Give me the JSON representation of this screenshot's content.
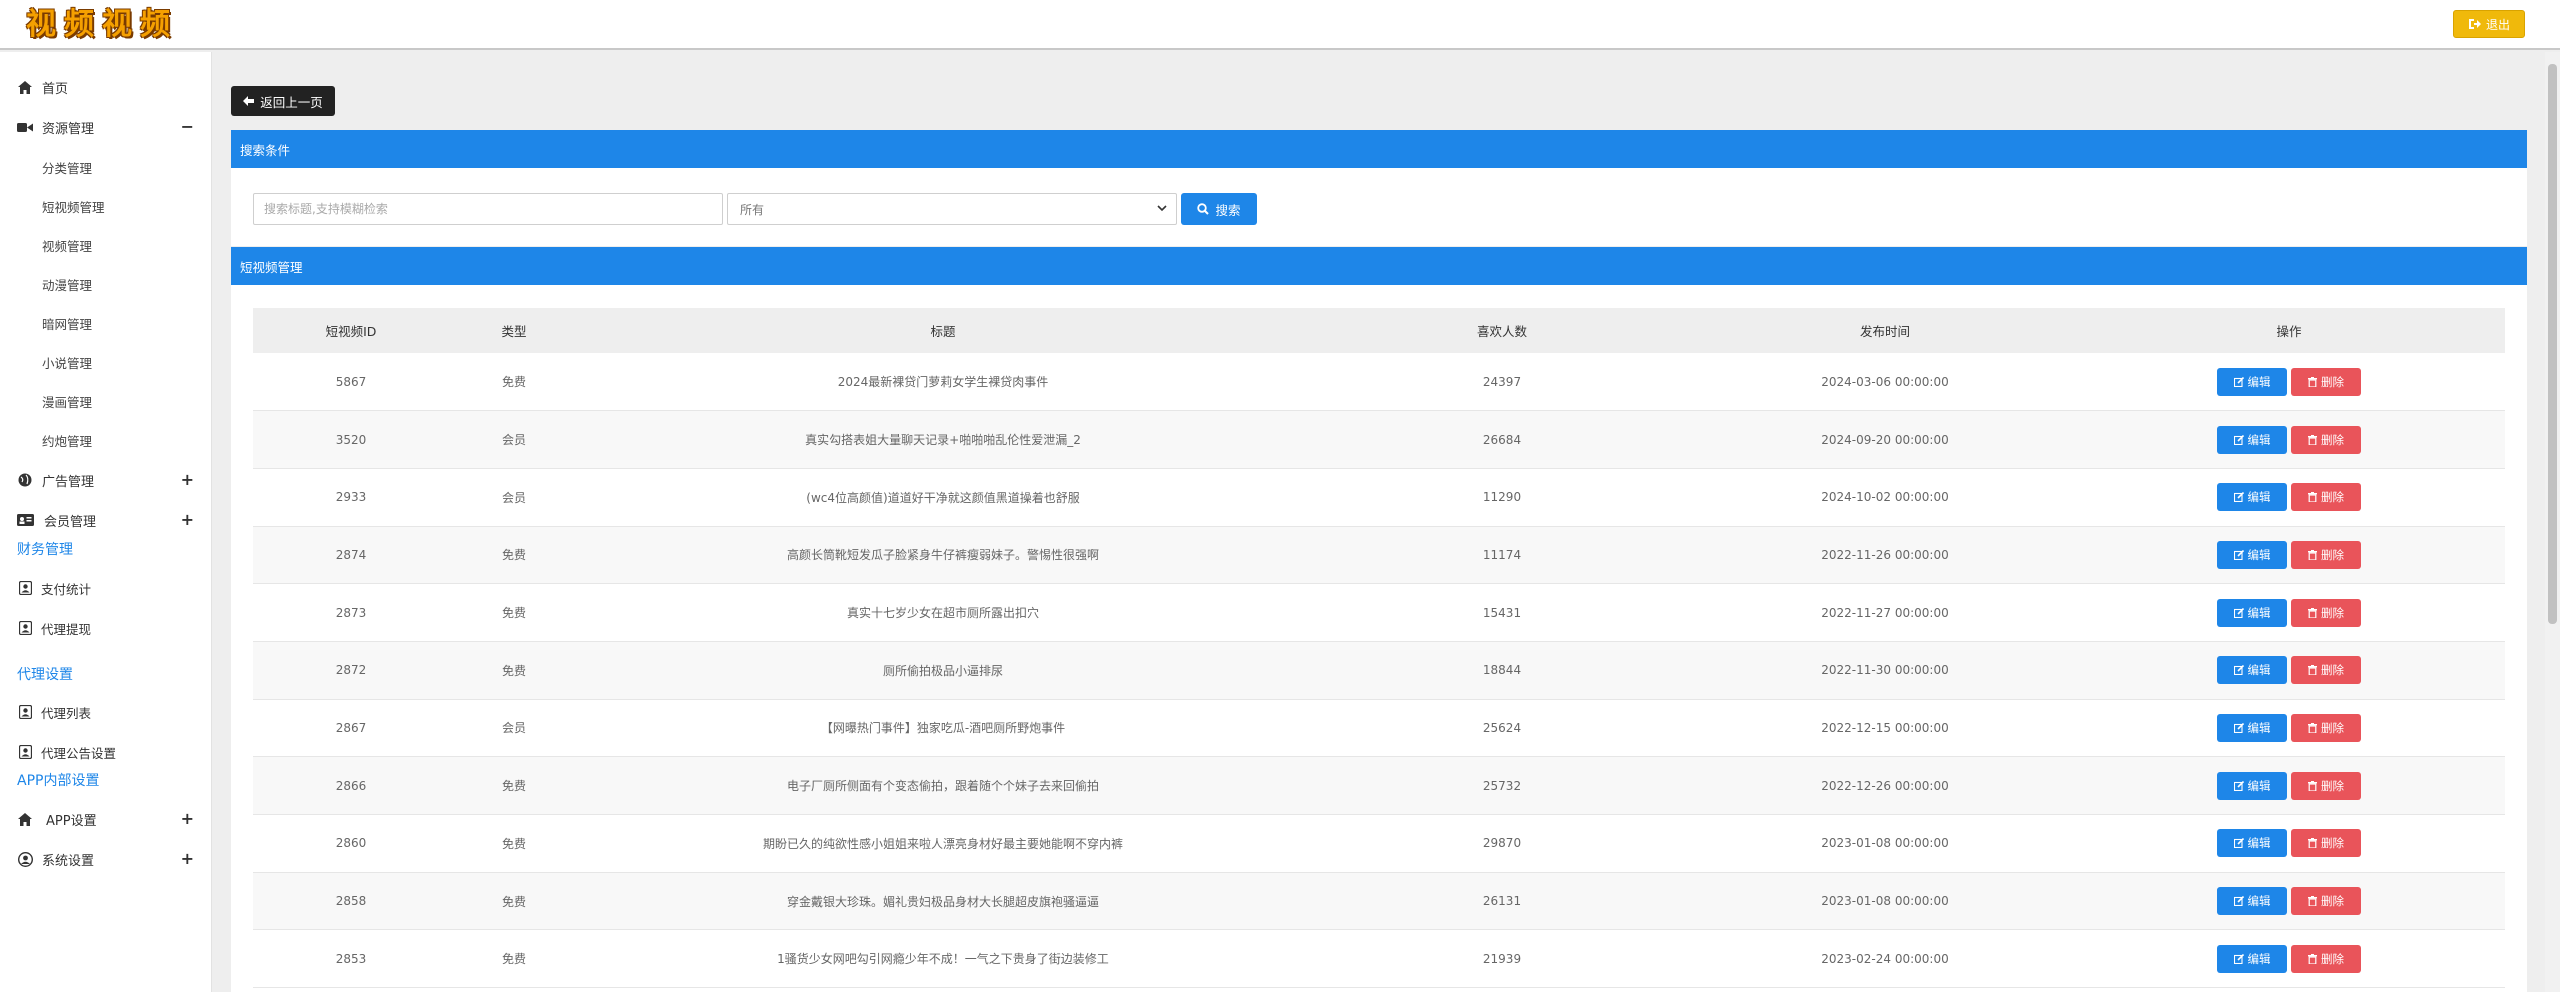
{
  "header": {
    "logo_text": "视频视频",
    "logout_label": "退出"
  },
  "sidebar": {
    "home": "首页",
    "resource": "资源管理",
    "resource_toggle": "−",
    "sub_items": [
      "分类管理",
      "短视频管理",
      "视频管理",
      "动漫管理",
      "暗网管理",
      "小说管理",
      "漫画管理",
      "约炮管理"
    ],
    "ads": "广告管理",
    "members": "会员管理",
    "finance_section": "财务管理",
    "payment_stats": "支付统计",
    "agent_withdraw": "代理提现",
    "agent_section": "代理设置",
    "agent_list": "代理列表",
    "agent_notice": "代理公告设置",
    "app_section": "APP内部设置",
    "app_settings": "APP设置",
    "system_settings": "系统设置",
    "plus": "+"
  },
  "main": {
    "back_label": "返回上一页",
    "search_panel_title": "搜索条件",
    "search_placeholder": "搜索标题,支持模糊检索",
    "select_value": "所有",
    "search_label": "搜索",
    "list_panel_title": "短视频管理",
    "columns": [
      "短视频ID",
      "类型",
      "标题",
      "喜欢人数",
      "发布时间",
      "操作"
    ],
    "edit_label": "编辑",
    "delete_label": "删除",
    "rows": [
      {
        "id": "5867",
        "type": "免费",
        "title": "2024最新裸贷门萝莉女学生裸贷肉事件",
        "likes": "24397",
        "time": "2024-03-06 00:00:00"
      },
      {
        "id": "3520",
        "type": "会员",
        "title": "真实勾搭表姐大量聊天记录+啪啪啪乱伦性爱泄漏_2",
        "likes": "26684",
        "time": "2024-09-20 00:00:00"
      },
      {
        "id": "2933",
        "type": "会员",
        "title": "(wc4位高颜值)道道好干净就这颜值黑道操着也舒服",
        "likes": "11290",
        "time": "2024-10-02 00:00:00"
      },
      {
        "id": "2874",
        "type": "免费",
        "title": "高颜长筒靴短发瓜子脸紧身牛仔裤瘦弱妹子。警惕性很强啊",
        "likes": "11174",
        "time": "2022-11-26 00:00:00"
      },
      {
        "id": "2873",
        "type": "免费",
        "title": "真实十七岁少女在超市厕所露出扣穴",
        "likes": "15431",
        "time": "2022-11-27 00:00:00"
      },
      {
        "id": "2872",
        "type": "免费",
        "title": "厕所偷拍极品小逼排尿",
        "likes": "18844",
        "time": "2022-11-30 00:00:00"
      },
      {
        "id": "2867",
        "type": "会员",
        "title": "【网曝热门事件】独家吃瓜-酒吧厕所野炮事件",
        "likes": "25624",
        "time": "2022-12-15 00:00:00"
      },
      {
        "id": "2866",
        "type": "免费",
        "title": "电子厂厕所侧面有个变态偷拍，跟着随个个妹子去来回偷拍",
        "likes": "25732",
        "time": "2022-12-26 00:00:00"
      },
      {
        "id": "2860",
        "type": "免费",
        "title": "期盼已久的纯欲性感小姐姐来啦人漂亮身材好最主要她能啊不穿内裤",
        "likes": "29870",
        "time": "2023-01-08 00:00:00"
      },
      {
        "id": "2858",
        "type": "免费",
        "title": "穿金戴银大珍珠。媚礼贵妇极品身材大长腿超皮旗袍骚逼逼",
        "likes": "26131",
        "time": "2023-01-08 00:00:00"
      },
      {
        "id": "2853",
        "type": "免费",
        "title": "1骚货少女网吧勾引网瘾少年不成！一气之下贵身了街边装修工",
        "likes": "21939",
        "time": "2023-02-24 00:00:00"
      }
    ]
  },
  "colors": {
    "accent": "#1e86e8",
    "danger": "#e9545a",
    "warning": "#f0b90b"
  }
}
